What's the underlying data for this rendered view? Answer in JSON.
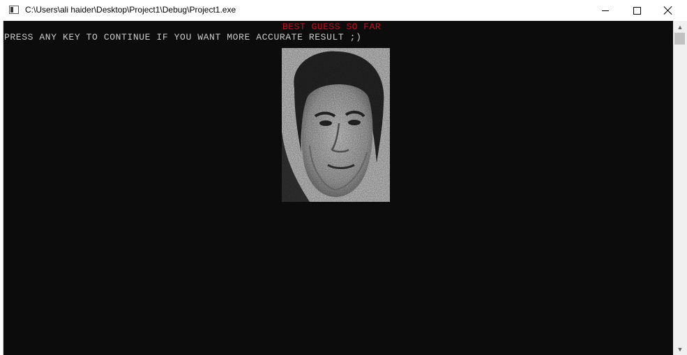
{
  "window": {
    "title": "C:\\Users\\ali haider\\Desktop\\Project1\\Debug\\Project1.exe",
    "icons": [
      "console-app-icon",
      "minimize-icon",
      "maximize-icon",
      "close-icon"
    ]
  },
  "console": {
    "heading": "BEST GUESS SO FAR",
    "prompt": "PRESS ANY KEY TO CONTINUE IF YOU WANT MORE ACCURATE RESULT ;)",
    "colors": {
      "background": "#0c0c0c",
      "text": "#cccccc",
      "heading": "#c50f1f"
    }
  },
  "scrollbar": {
    "icons": [
      "scroll-up-arrow-icon",
      "scroll-down-arrow-icon"
    ]
  }
}
